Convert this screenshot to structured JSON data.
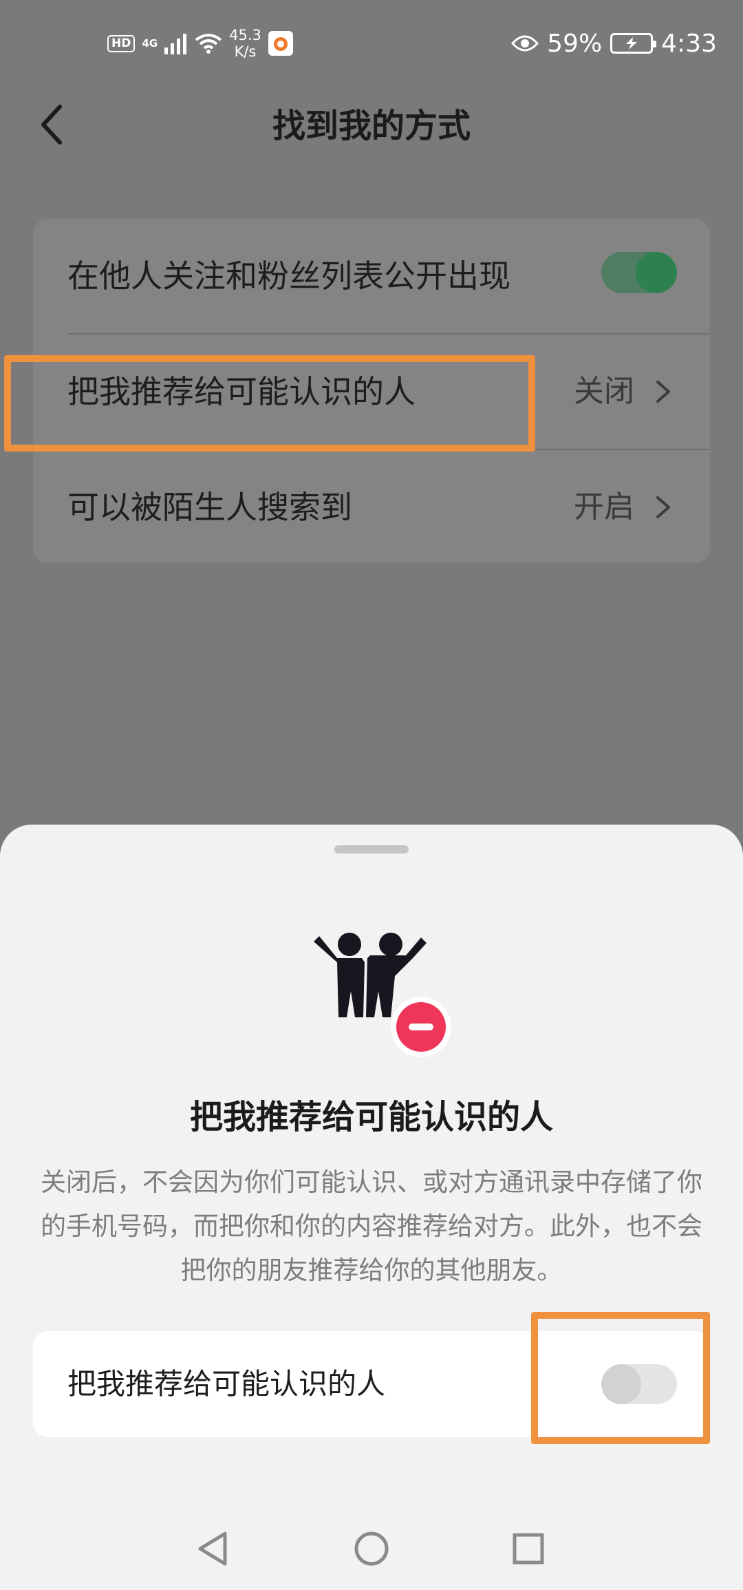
{
  "status_bar": {
    "hd": "HD",
    "network": "4G",
    "speed_value": "45.3",
    "speed_unit": "K/s",
    "battery": "59%",
    "time": "4:33",
    "icons": [
      "signal-icon",
      "wifi-icon",
      "app-notification-icon",
      "eye-icon",
      "battery-charging-icon"
    ]
  },
  "header": {
    "title": "找到我的方式",
    "back_icon": "chevron-left-icon"
  },
  "settings": {
    "rows": [
      {
        "label": "在他人关注和粉丝列表公开出现",
        "control": "toggle",
        "state": "on"
      },
      {
        "label": "把我推荐给可能认识的人",
        "value": "关闭"
      },
      {
        "label": "可以被陌生人搜索到",
        "value": "开启"
      }
    ]
  },
  "sheet": {
    "title": "把我推荐给可能认识的人",
    "description": "关闭后，不会因为你们可能认识、或对方通讯录中存储了你的手机号码，而把你和你的内容推荐给对方。此外，也不会把你的朋友推荐给你的其他朋友。",
    "illustration_icon": "friends-remove-icon",
    "toggle_label": "把我推荐给可能认识的人",
    "toggle_state": "off"
  },
  "colors": {
    "accent_green": "#2f8050",
    "highlight_orange": "#f0913f",
    "remove_red": "#f0355a"
  },
  "nav_bar": {
    "icons": [
      "nav-back-icon",
      "nav-home-icon",
      "nav-recents-icon"
    ]
  }
}
